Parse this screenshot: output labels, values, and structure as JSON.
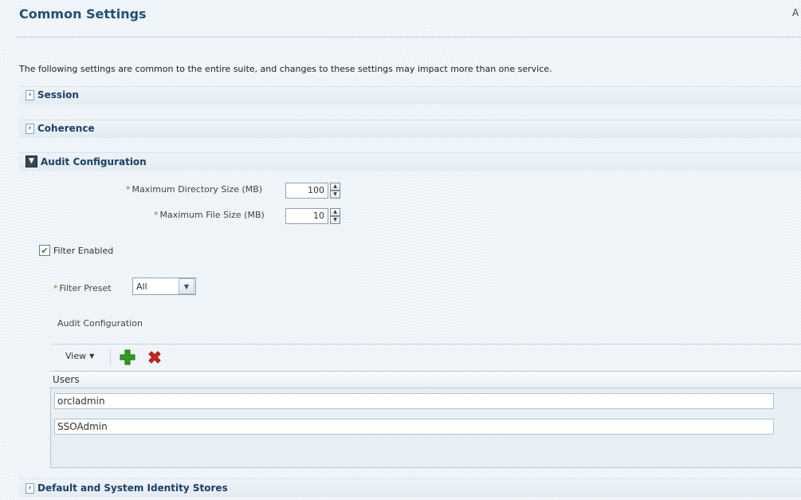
{
  "header": {
    "title": "Common Settings",
    "right_action": "A"
  },
  "intro": "The following settings are common to the entire suite, and changes to these settings may impact more than one service.",
  "sections": {
    "session": "Session",
    "coherence": "Coherence",
    "audit": "Audit Configuration",
    "identity": "Default and System Identity Stores"
  },
  "audit": {
    "required_marker": "*",
    "max_dir_label": "Maximum Directory Size (MB)",
    "max_dir_value": "100",
    "max_file_label": "Maximum File Size (MB)",
    "max_file_value": "10",
    "filter_enabled_label": "Filter Enabled",
    "filter_enabled_checked": true,
    "filter_preset_label": "Filter Preset",
    "filter_preset_value": "All",
    "subsection_title": "Audit Configuration"
  },
  "toolbar": {
    "view_label": "View"
  },
  "table": {
    "columns": [
      "Users"
    ],
    "rows": [
      "orcladmin",
      "SSOAdmin"
    ]
  },
  "icons": {
    "disclosure_collapsed": "chevron-right-icon",
    "disclosure_expanded": "chevron-down-icon",
    "add": "plus-icon",
    "delete": "x-icon",
    "accent_green": "#2e9e1f",
    "accent_red": "#d6261c"
  }
}
